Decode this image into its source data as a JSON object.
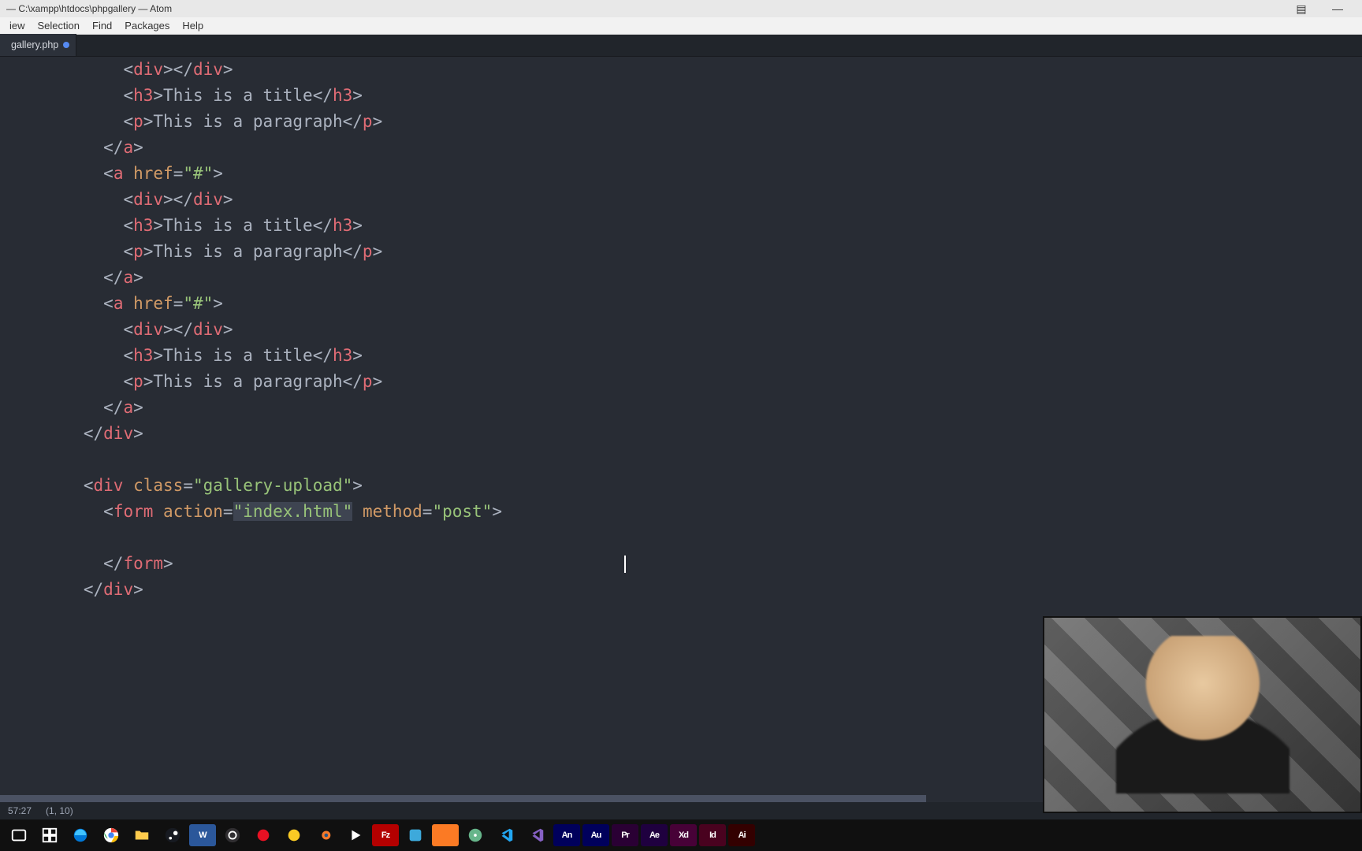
{
  "window": {
    "title": "— C:\\xampp\\htdocs\\phpgallery — Atom"
  },
  "menu": {
    "items": [
      "iew",
      "Selection",
      "Find",
      "Packages",
      "Help"
    ]
  },
  "tabs": {
    "active": {
      "label": "gallery.php",
      "modified": true
    }
  },
  "code": {
    "indent": {
      "i3": "      ",
      "i4": "        ",
      "i5": "          "
    },
    "tags": {
      "div": "div",
      "h3": "h3",
      "p": "p",
      "a": "a",
      "form": "form"
    },
    "attrs": {
      "href": "href",
      "class": "class",
      "action": "action",
      "method": "method"
    },
    "strings": {
      "hash": "\"#\"",
      "gallery_upload": "\"gallery-upload\"",
      "index_html": "\"index.html\"",
      "post": "\"post\""
    },
    "text": {
      "title": "This is a title",
      "paragraph": "This is a paragraph"
    }
  },
  "status": {
    "time": "57:27",
    "pos": "(1, 10)"
  },
  "taskbar": {
    "apps": [
      {
        "name": "task-view-icon",
        "kind": "svg",
        "svg": "taskview",
        "bg": ""
      },
      {
        "name": "window-switcher-icon",
        "kind": "svg",
        "svg": "multiwin",
        "bg": ""
      },
      {
        "name": "edge-browser-icon",
        "kind": "svg",
        "svg": "edge",
        "bg": ""
      },
      {
        "name": "chrome-browser-icon",
        "kind": "svg",
        "svg": "chrome",
        "bg": ""
      },
      {
        "name": "file-explorer-icon",
        "kind": "svg",
        "svg": "folder",
        "bg": ""
      },
      {
        "name": "steam-icon",
        "kind": "svg",
        "svg": "steam",
        "bg": ""
      },
      {
        "name": "word-icon",
        "kind": "sq",
        "label": "W",
        "bg": "#2b579a"
      },
      {
        "name": "obs-icon",
        "kind": "svg",
        "svg": "obs",
        "bg": ""
      },
      {
        "name": "record-icon",
        "kind": "svg",
        "svg": "redcircle",
        "bg": ""
      },
      {
        "name": "app-icon-1",
        "kind": "svg",
        "svg": "yellowball",
        "bg": ""
      },
      {
        "name": "blender-icon",
        "kind": "svg",
        "svg": "blender",
        "bg": ""
      },
      {
        "name": "media-player-icon",
        "kind": "svg",
        "svg": "play",
        "bg": ""
      },
      {
        "name": "filezilla-icon",
        "kind": "sq",
        "label": "Fz",
        "bg": "#b40000"
      },
      {
        "name": "app-icon-2",
        "kind": "svg",
        "svg": "bluesq",
        "bg": ""
      },
      {
        "name": "xampp-icon",
        "kind": "sq",
        "label": "",
        "bg": "#fb7a24"
      },
      {
        "name": "atom-icon",
        "kind": "svg",
        "svg": "atom",
        "bg": ""
      },
      {
        "name": "vscode-icon",
        "kind": "svg",
        "svg": "vscode",
        "bg": ""
      },
      {
        "name": "visual-studio-icon",
        "kind": "svg",
        "svg": "vs",
        "bg": ""
      },
      {
        "name": "animate-icon",
        "kind": "sq",
        "label": "An",
        "bg": "#00005b"
      },
      {
        "name": "audition-icon",
        "kind": "sq",
        "label": "Au",
        "bg": "#00005b"
      },
      {
        "name": "premiere-icon",
        "kind": "sq",
        "label": "Pr",
        "bg": "#2a0034"
      },
      {
        "name": "after-effects-icon",
        "kind": "sq",
        "label": "Ae",
        "bg": "#1f003f"
      },
      {
        "name": "xd-icon",
        "kind": "sq",
        "label": "Xd",
        "bg": "#470137"
      },
      {
        "name": "indesign-icon",
        "kind": "sq",
        "label": "Id",
        "bg": "#49021f"
      },
      {
        "name": "illustrator-icon",
        "kind": "sq",
        "label": "Ai",
        "bg": "#330000"
      }
    ]
  }
}
